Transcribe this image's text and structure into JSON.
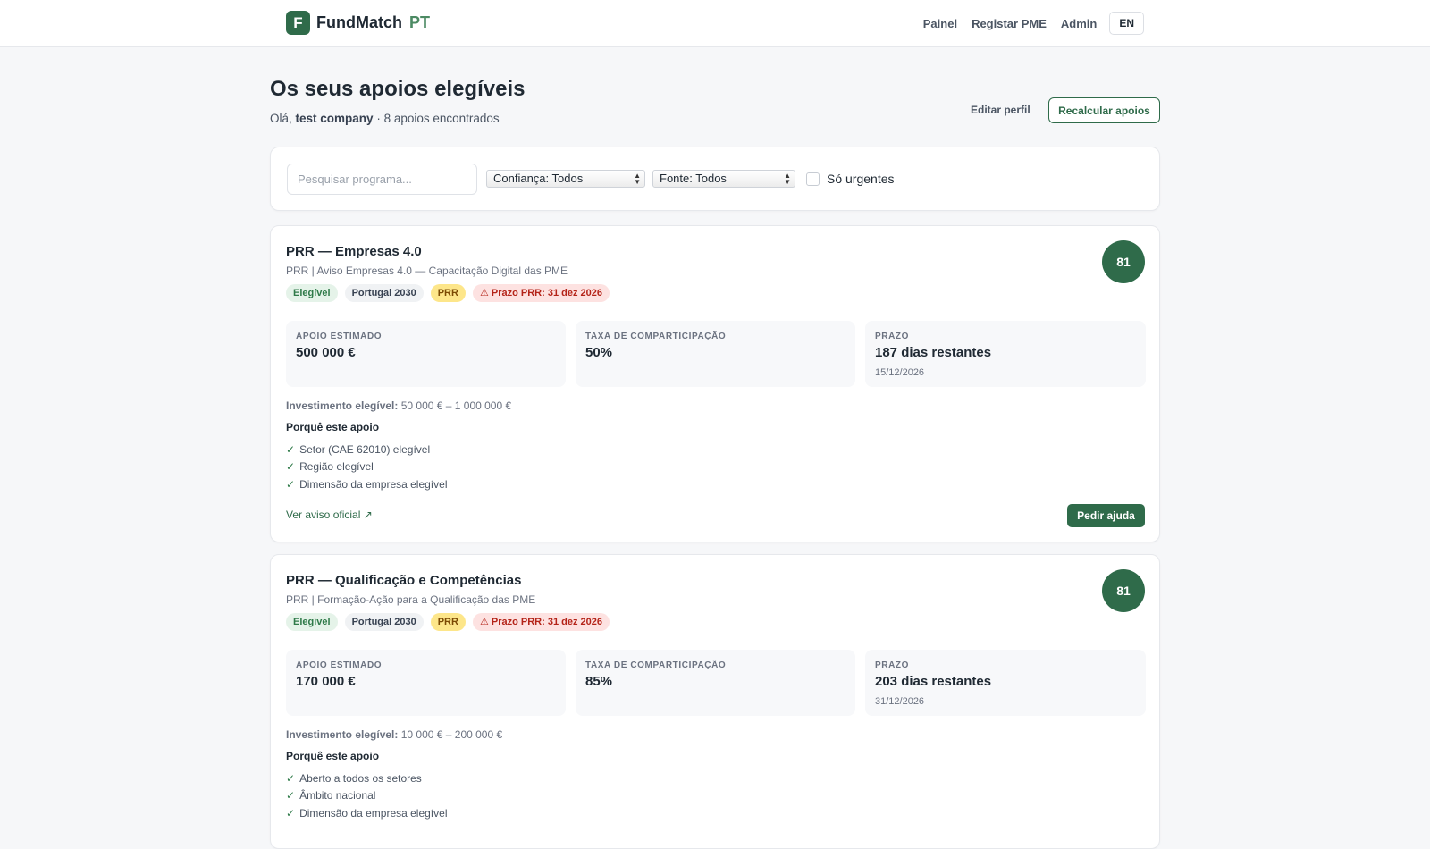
{
  "header": {
    "logo_letter": "F",
    "brand_name": "FundMatch",
    "brand_suffix": "PT",
    "nav": [
      "Painel",
      "Registar PME",
      "Admin"
    ],
    "lang_button": "EN"
  },
  "page": {
    "title": "Os seus apoios elegíveis",
    "greeting_prefix": "Olá,",
    "company": "test company",
    "count_text": "· 8 apoios encontrados",
    "edit_profile": "Editar perfil",
    "recalc_button": "Recalcular apoios"
  },
  "filters": {
    "search_placeholder": "Pesquisar programa...",
    "confidence_select": "Confiança: Todos",
    "source_select": "Fonte: Todos",
    "urgent_label": "Só urgentes"
  },
  "cards": [
    {
      "title": "PRR — Empresas 4.0",
      "subtitle": "PRR | Aviso Empresas 4.0 — Capacitação Digital das PME",
      "badges": [
        "Elegível",
        "Portugal 2030",
        "PRR",
        "⚠ Prazo PRR: 31 dez 2026"
      ],
      "score": "81",
      "stats": {
        "support_label": "APOIO ESTIMADO",
        "support_value": "500 000 €",
        "rate_label": "TAXA DE COMPARTICIPAÇÃO",
        "rate_value": "50%",
        "deadline_label": "PRAZO",
        "deadline_value": "187 dias restantes",
        "deadline_date": "15/12/2026"
      },
      "invest_label": "Investimento elegível:",
      "invest_value": "50 000 € – 1 000 000 €",
      "why_title": "Porquê este apoio",
      "reasons": [
        "Setor (CAE 62010) elegível",
        "Região elegível",
        "Dimensão da empresa elegível"
      ],
      "official_link": "Ver aviso oficial ↗",
      "help_button": "Pedir ajuda"
    },
    {
      "title": "PRR — Qualificação e Competências",
      "subtitle": "PRR | Formação-Ação para a Qualificação das PME",
      "badges": [
        "Elegível",
        "Portugal 2030",
        "PRR",
        "⚠ Prazo PRR: 31 dez 2026"
      ],
      "score": "81",
      "stats": {
        "support_label": "APOIO ESTIMADO",
        "support_value": "170 000 €",
        "rate_label": "TAXA DE COMPARTICIPAÇÃO",
        "rate_value": "85%",
        "deadline_label": "PRAZO",
        "deadline_value": "203 dias restantes",
        "deadline_date": "31/12/2026"
      },
      "invest_label": "Investimento elegível:",
      "invest_value": "10 000 € – 200 000 €",
      "why_title": "Porquê este apoio",
      "reasons": [
        "Aberto a todos os setores",
        "Âmbito nacional",
        "Dimensão da empresa elegível"
      ]
    }
  ],
  "colors": {
    "brand_green": "#2f6b4a",
    "eligible_badge": "#e5f3e9",
    "prr_badge": "#fde68a",
    "deadline_badge": "#fde2e1"
  }
}
